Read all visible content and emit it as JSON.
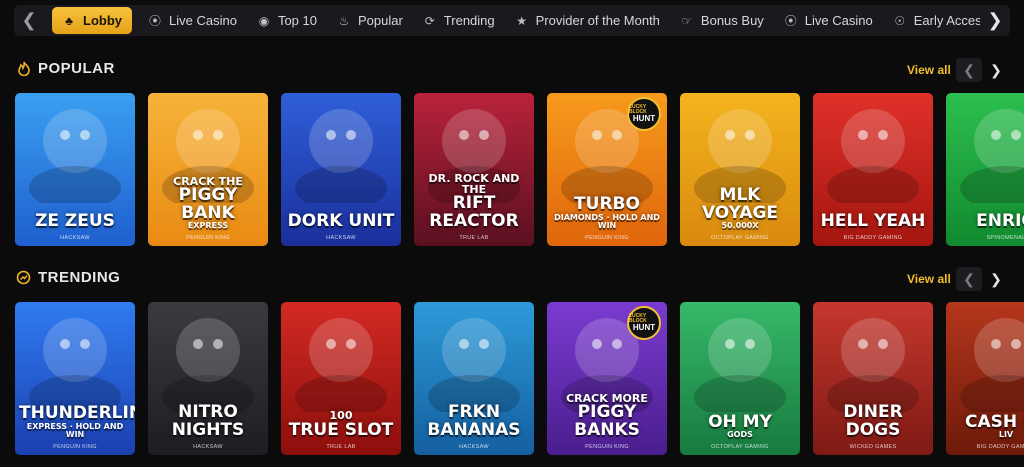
{
  "nav": {
    "items": [
      {
        "label": "Lobby",
        "icon": "clubs-icon",
        "active": true
      },
      {
        "label": "Live Casino",
        "icon": "broadcast-icon"
      },
      {
        "label": "Top 10",
        "icon": "medal-icon"
      },
      {
        "label": "Popular",
        "icon": "flame-icon"
      },
      {
        "label": "Trending",
        "icon": "trending-icon"
      },
      {
        "label": "Provider of the Month",
        "icon": "star-icon"
      },
      {
        "label": "Bonus Buy",
        "icon": "bonus-hand-icon"
      },
      {
        "label": "Live Casino",
        "icon": "broadcast-icon"
      },
      {
        "label": "Early Access",
        "icon": "early-access-icon"
      }
    ]
  },
  "popular": {
    "title": "POPULAR",
    "view_all": "View all",
    "games": [
      {
        "t2": "ZE ZEUS",
        "provider": "HACKSAW",
        "colors": [
          "#3aa0f0",
          "#1f5fcf"
        ]
      },
      {
        "t1": "CRACK THE",
        "t2": "PIGGY BANK",
        "t3": "EXPRESS",
        "provider": "PENGUIN KING",
        "colors": [
          "#f7b33a",
          "#e98a12"
        ]
      },
      {
        "t2": "DORK UNIT",
        "provider": "HACKSAW",
        "colors": [
          "#2f5fd8",
          "#1b2f9c"
        ]
      },
      {
        "t1": "DR. ROCK AND THE",
        "t2": "RIFT REACTOR",
        "provider": "TRUE LAB",
        "colors": [
          "#b9233a",
          "#5a1020"
        ]
      },
      {
        "t2": "TURBO",
        "t3": "DIAMONDS · HOLD AND WIN",
        "provider": "PENGUIN KING",
        "colors": [
          "#f69a1c",
          "#e0660c"
        ],
        "badge": [
          "LUCKY BLOCK",
          "HUNT"
        ]
      },
      {
        "t2": "MLK VOYAGE",
        "t3": "50.000X",
        "provider": "OCTOPLAY GAMING",
        "colors": [
          "#f4b41e",
          "#d98a0e"
        ]
      },
      {
        "t2": "HELL YEAH",
        "provider": "BIG DADDY GAMING",
        "colors": [
          "#e0312a",
          "#a3160f"
        ]
      },
      {
        "t2": "ENRIQ",
        "provider": "SPINOMENAL",
        "colors": [
          "#2dbf4f",
          "#118a2f"
        ]
      }
    ]
  },
  "trending": {
    "title": "TRENDING",
    "view_all": "View all",
    "games": [
      {
        "t2": "THUNDERLINE",
        "t3": "EXPRESS · HOLD AND WIN",
        "provider": "PENGUIN KING",
        "colors": [
          "#2f7cf0",
          "#1b3fb0"
        ]
      },
      {
        "t2": "NITRO NIGHTS",
        "provider": "HACKSAW",
        "colors": [
          "#3a3a40",
          "#1d1d22"
        ]
      },
      {
        "t1": "100",
        "t2": "TRUE SLOT",
        "provider": "TRUE LAB",
        "colors": [
          "#d42a24",
          "#8c0f0c"
        ]
      },
      {
        "t2": "FRKN BANANAS",
        "provider": "HACKSAW",
        "colors": [
          "#2d9ad8",
          "#155fa0"
        ]
      },
      {
        "t1": "CRACK MORE",
        "t2": "PIGGY BANKS",
        "provider": "PENGUIN KING",
        "colors": [
          "#7b3bd0",
          "#4a1e8e"
        ],
        "badge": [
          "LUCKY BLOCK",
          "HUNT"
        ]
      },
      {
        "t2": "OH MY",
        "t3": "GODS",
        "provider": "OCTOPLAY GAMING",
        "colors": [
          "#37b96a",
          "#177a3e"
        ]
      },
      {
        "t2": "DINER DOGS",
        "provider": "WICKED GAMES",
        "colors": [
          "#c6372e",
          "#7e1a14"
        ]
      },
      {
        "t2": "CASH LA",
        "t3": "LIV",
        "provider": "BIG DADDY GAMING",
        "colors": [
          "#b5361c",
          "#6e1a0a"
        ]
      }
    ]
  },
  "colors": {
    "accent": "#f1bf2a",
    "bg": "#0b0b0c",
    "nav_bg": "#1a1a1e"
  }
}
